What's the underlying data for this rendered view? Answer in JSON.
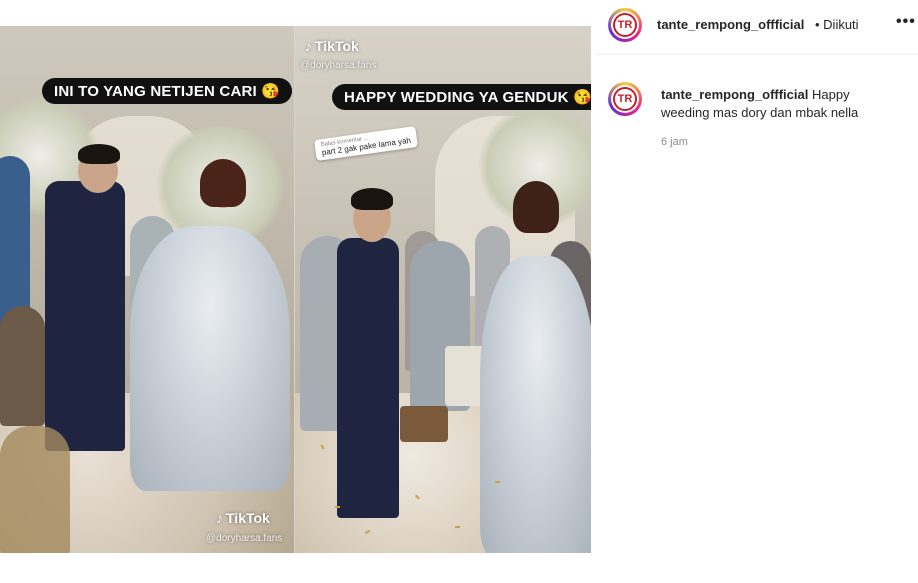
{
  "media": {
    "left_panel": {
      "caption": "INI TO YANG NETIJEN CARI 😘",
      "tiktok_label": "TikTok",
      "handle": "@doryharsa.fans"
    },
    "right_panel": {
      "tiktok_label": "TikTok",
      "handle": "@doryharsa.fans",
      "caption": "HAPPY WEDDING YA GENDUK 😘",
      "reply_note_title": "Balas komentar ...",
      "reply_note_text": "part 2 gak pake lama yah"
    }
  },
  "post": {
    "username": "tante_rempong_offficial",
    "follow_status": "• Diikuti",
    "more_icon": "•••",
    "caption_username": "tante_rempong_offficial",
    "caption_text": "Happy weeding mas dory dan mbak nella",
    "time_ago": "6 jam"
  },
  "colors": {
    "brand_red": "#c8202a",
    "text": "#262626",
    "muted": "#8e8e8e"
  },
  "icons": {
    "avatar": "tante-rempong-logo",
    "tiktok": "tiktok-icon",
    "more": "more-options-icon"
  }
}
